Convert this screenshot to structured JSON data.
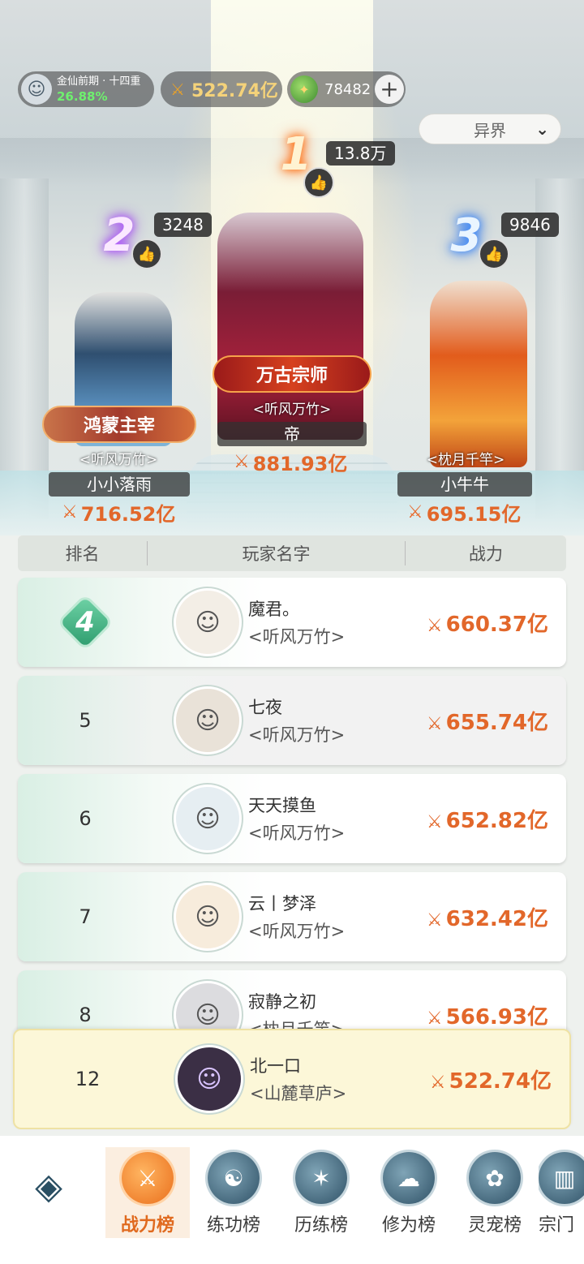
{
  "header": {
    "realm_label": "金仙前期 · 十四重",
    "realm_percent": "26.88%",
    "power": "522.74亿",
    "currency": "78482",
    "plus_icon": "+"
  },
  "server_select": {
    "selected": "异界"
  },
  "podium": {
    "first": {
      "rank": "1",
      "likes": "13.8万",
      "title": "万古宗师",
      "guild": "<听风万竹>",
      "name": "帝",
      "power": "881.93亿"
    },
    "second": {
      "rank": "2",
      "likes": "3248",
      "title": "鸿蒙主宰",
      "guild": "<听风万竹>",
      "name": "小小落雨",
      "power": "716.52亿"
    },
    "third": {
      "rank": "3",
      "likes": "9846",
      "guild": "<枕月千竿>",
      "name": "小牛牛",
      "power": "695.15亿"
    }
  },
  "table": {
    "headers": {
      "rank": "排名",
      "name": "玩家名字",
      "power": "战力"
    },
    "rows": [
      {
        "rank": "4",
        "name": "魔君。",
        "guild": "<听风万竹>",
        "power": "660.37亿"
      },
      {
        "rank": "5",
        "name": "七夜",
        "guild": "<听风万竹>",
        "power": "655.74亿"
      },
      {
        "rank": "6",
        "name": "天天摸鱼",
        "guild": "<听风万竹>",
        "power": "652.82亿"
      },
      {
        "rank": "7",
        "name": "云丨梦泽",
        "guild": "<听风万竹>",
        "power": "632.42亿"
      },
      {
        "rank": "8",
        "name": "寂静之初",
        "guild": "<枕月千竿>",
        "power": "566.93亿"
      }
    ]
  },
  "self_row": {
    "rank": "12",
    "name": "北一口",
    "guild": "<山麓草庐>",
    "power": "522.74亿"
  },
  "nav": {
    "tabs": [
      {
        "label": "战力榜"
      },
      {
        "label": "练功榜"
      },
      {
        "label": "历练榜"
      },
      {
        "label": "修为榜"
      },
      {
        "label": "灵宠榜"
      },
      {
        "label": "宗门"
      }
    ]
  },
  "colors": {
    "accent": "#e2672a",
    "self_highlight": "#fcf7d8",
    "rank4": "#2e9d6e"
  },
  "icons": {
    "sword": "sword-icon",
    "thumb": "thumbs-up-icon",
    "coin": "spirit-coin-icon",
    "chevron": "chevron-down-icon",
    "home": "home-icon"
  }
}
